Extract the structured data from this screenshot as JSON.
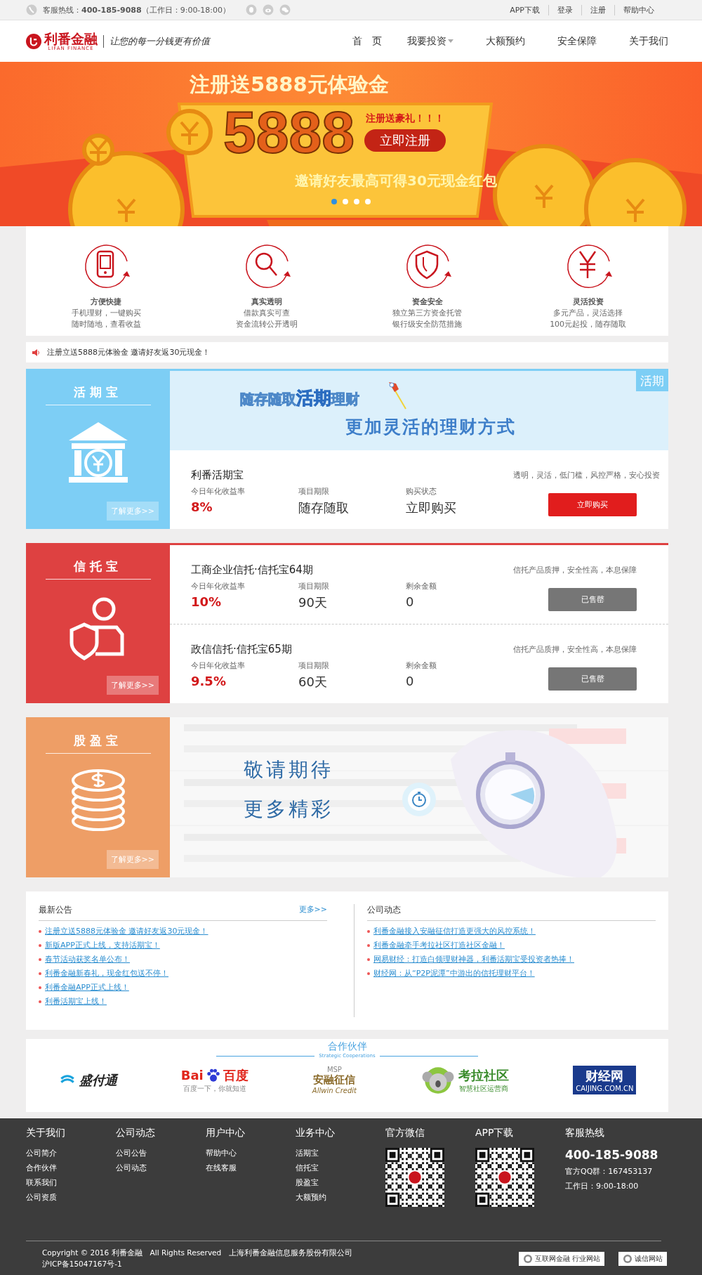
{
  "top_bar": {
    "hotline": "客服热线：**400-185-9088**（工作日：9:00-18:00）",
    "links": [
      "APP下载",
      "登录",
      "注册",
      "帮助中心"
    ]
  },
  "header": {
    "logo": {
      "name": "利番金融",
      "sub": "LIFAN FINANCE"
    },
    "slogan": "让您的每一分钱更有价值",
    "nav": [
      {
        "label": "首　页",
        "has_menu": false
      },
      {
        "label": "我要投资",
        "has_menu": true
      },
      {
        "label": "大额预约",
        "has_menu": false
      },
      {
        "label": "安全保障",
        "has_menu": false
      },
      {
        "label": "关于我们",
        "has_menu": false
      }
    ]
  },
  "banner": {
    "title": "注册送5888元体验金",
    "amount": "5888",
    "gift": "注册送豪礼！！！",
    "button": "立即注册",
    "invite": "邀请好友最高可得30元现金红包",
    "dots": [
      {
        "selected": true
      },
      {
        "selected": false
      },
      {
        "selected": false
      },
      {
        "selected": false
      }
    ]
  },
  "features": [
    {
      "kind": "phone",
      "title": "方便快捷",
      "lines": [
        "手机理财，一键购买",
        "随时随地，查看收益"
      ]
    },
    {
      "kind": "search",
      "title": "真实透明",
      "lines": [
        "借款真实可查",
        "资金流转公开透明"
      ]
    },
    {
      "kind": "shield",
      "title": "资金安全",
      "lines": [
        "独立第三方资金托管",
        "银行级安全防范措施"
      ]
    },
    {
      "kind": "yen",
      "title": "灵活投资",
      "lines": [
        "多元产品，灵活选择",
        "100元起投，随存随取"
      ]
    }
  ],
  "notice": "注册立送5888元体验金 邀请好友返30元现金！",
  "products": [
    {
      "name": "活期宝",
      "kind": "bank",
      "color": "#7dcef5",
      "more": "了解更多>>",
      "promo": {
        "tag": "活期",
        "line1": "随存随取**活期**理财",
        "line2": "更加灵活的理财方式"
      },
      "items": [
        {
          "title": "利番活期宝",
          "desc": "透明，灵活，低门槛，风控严格，安心投资",
          "fields": [
            {
              "label": "今日年化收益率",
              "value": "8%",
              "kind": "rate"
            },
            {
              "label": "项目期限",
              "value": "随存随取",
              "kind": "plain"
            },
            {
              "label": "购买状态",
              "value": "立即购买",
              "kind": "plain"
            }
          ],
          "button": {
            "label": "立即购买",
            "disabled": false
          }
        }
      ]
    },
    {
      "name": "信托宝",
      "kind": "person-shield",
      "color": "#de4141",
      "more": "了解更多>>",
      "items": [
        {
          "title": "工商企业信托·信托宝64期",
          "desc": "信托产品质押，安全性高，本息保障",
          "fields": [
            {
              "label": "今日年化收益率",
              "value": "10%",
              "kind": "rate"
            },
            {
              "label": "项目期限",
              "value": "90天",
              "kind": "plain"
            },
            {
              "label": "剩余金额",
              "value": "0",
              "kind": "plain"
            }
          ],
          "button": {
            "label": "已售罄",
            "disabled": true
          }
        },
        {
          "title": "政信信托·信托宝65期",
          "desc": "信托产品质押，安全性高，本息保障",
          "fields": [
            {
              "label": "今日年化收益率",
              "value": "9.5%",
              "kind": "rate"
            },
            {
              "label": "项目期限",
              "value": "60天",
              "kind": "plain"
            },
            {
              "label": "剩余金额",
              "value": "0",
              "kind": "plain"
            }
          ],
          "button": {
            "label": "已售罄",
            "disabled": true
          }
        }
      ]
    },
    {
      "name": "股盈宝",
      "kind": "coins",
      "color": "#ee9e66",
      "more": "了解更多>>",
      "coming_soon": [
        "敬请期待",
        "更多精彩"
      ]
    }
  ],
  "news": [
    {
      "title": "最新公告",
      "more": "更多>>",
      "items": [
        "注册立送5888元体验金 邀请好友返30元现金！",
        "新版APP正式上线，支持活期宝！",
        "春节活动获奖名单公布！",
        "利番金融新春礼，现金红包送不停！",
        "利番金融APP正式上线！",
        "利番活期宝上线！"
      ]
    },
    {
      "title": "公司动态",
      "items": [
        "利番金融接入安融征信打造更强大的风控系统！",
        "利番金融牵手考拉社区打造社区金融！",
        "网易财经：打造白领理财神器，利番活期宝受投资者热捧！",
        "财经网：从“P2P泥潭”中游出的信托理财平台！"
      ]
    }
  ],
  "partners": {
    "title": "合作伙伴",
    "subtitle": "Strategic Cooperations",
    "logos": [
      {
        "kind": "wave",
        "name": "盛付通"
      },
      {
        "kind": "paw",
        "name": "Bai",
        "name2": "百度",
        "sub": "百度一下，你就知道"
      },
      {
        "kind": "seal",
        "name": "安融征信",
        "top": "MSP",
        "sub": "Allwin Credit"
      },
      {
        "kind": "koala",
        "name": "考拉社区",
        "sub": "智慧社区运营商"
      },
      {
        "kind": "box",
        "name": "财经网",
        "sub": "CAIJING.COM.CN"
      }
    ]
  },
  "footer": {
    "columns": [
      {
        "title": "关于我们",
        "links": [
          "公司简介",
          "合作伙伴",
          "联系我们",
          "公司资质"
        ]
      },
      {
        "title": "公司动态",
        "links": [
          "公司公告",
          "公司动态"
        ]
      },
      {
        "title": "用户中心",
        "links": [
          "帮助中心",
          "在线客服"
        ]
      },
      {
        "title": "业务中心",
        "links": [
          "活期宝",
          "信托宝",
          "股盈宝",
          "大额预约"
        ]
      }
    ],
    "qr_codes": [
      {
        "title": "官方微信"
      },
      {
        "title": "APP下载"
      }
    ],
    "contact": {
      "title": "客服热线",
      "phone": "400-185-9088",
      "qq": "官方QQ群：167453137",
      "hours": "工作日：9:00-18:00"
    },
    "copyright": [
      "Copyright © 2016 利番金融　All Rights Reserved　上海利番金融信息服务股份有限公司",
      "沪ICP备15047167号-1"
    ],
    "badges": [
      "互联网金融 行业网站",
      "诚信网站"
    ]
  }
}
